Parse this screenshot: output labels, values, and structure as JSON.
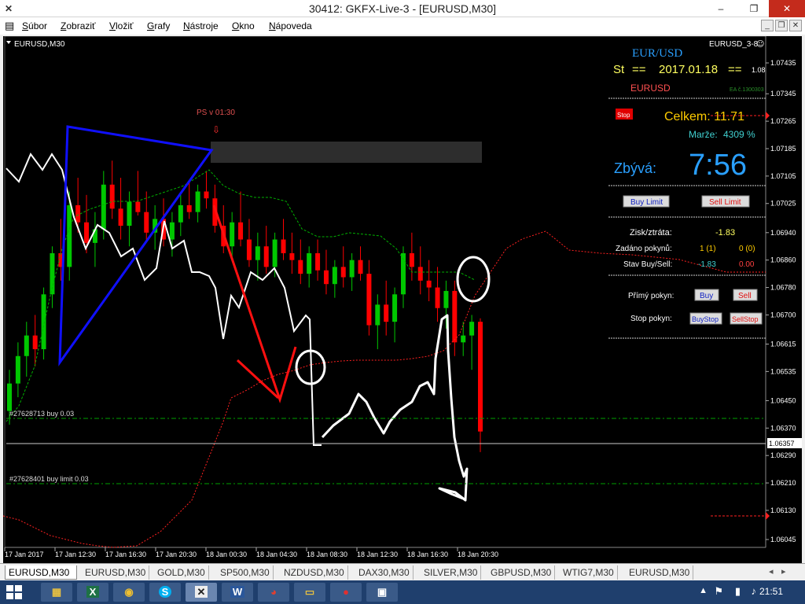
{
  "window": {
    "title": "30412: GKFX-Live-3 - [EURUSD,M30]",
    "minimize": "–",
    "restore": "❐",
    "close": "✕"
  },
  "menu": [
    "Súbor",
    "Zobraziť",
    "Vložiť",
    "Grafy",
    "Nástroje",
    "Okno",
    "Nápoveda"
  ],
  "chart": {
    "symbol_label": "EURUSD,M30",
    "ea_name": "EURUSD_3-8",
    "ps_label": "PS v 01:30",
    "current_price": "1.06357",
    "price_ticks": [
      "1.07435",
      "1.07345",
      "1.07265",
      "1.07185",
      "1.07105",
      "1.07025",
      "1.06940",
      "1.06860",
      "1.06780",
      "1.06700",
      "1.06615",
      "1.06535",
      "1.06450",
      "1.06370",
      "1.06290",
      "1.06210",
      "1.06130",
      "1.06045"
    ],
    "time_ticks": [
      "17 Jan 2017",
      "17 Jan 12:30",
      "17 Jan 16:30",
      "17 Jan 20:30",
      "18 Jan 00:30",
      "18 Jan 04:30",
      "18 Jan 08:30",
      "18 Jan 12:30",
      "18 Jan 16:30",
      "18 Jan 20:30"
    ],
    "order_buy": "#27628713 buy 0.03",
    "order_buy_limit": "#27628401 buy limit 0.03",
    "candles": [
      {
        "o": 1.0642,
        "h": 1.0654,
        "l": 1.0638,
        "c": 1.065
      },
      {
        "o": 1.065,
        "h": 1.0662,
        "l": 1.0646,
        "c": 1.0658
      },
      {
        "o": 1.0658,
        "h": 1.0668,
        "l": 1.0652,
        "c": 1.0664
      },
      {
        "o": 1.0664,
        "h": 1.067,
        "l": 1.0655,
        "c": 1.066
      },
      {
        "o": 1.066,
        "h": 1.0678,
        "l": 1.0657,
        "c": 1.0676
      },
      {
        "o": 1.0676,
        "h": 1.069,
        "l": 1.0672,
        "c": 1.0688
      },
      {
        "o": 1.0688,
        "h": 1.0698,
        "l": 1.068,
        "c": 1.0684
      },
      {
        "o": 1.0684,
        "h": 1.0706,
        "l": 1.068,
        "c": 1.0702
      },
      {
        "o": 1.0702,
        "h": 1.071,
        "l": 1.0694,
        "c": 1.0697
      },
      {
        "o": 1.0697,
        "h": 1.0705,
        "l": 1.0688,
        "c": 1.0691
      },
      {
        "o": 1.0691,
        "h": 1.07,
        "l": 1.0684,
        "c": 1.0695
      },
      {
        "o": 1.0695,
        "h": 1.0712,
        "l": 1.0692,
        "c": 1.0708
      },
      {
        "o": 1.0708,
        "h": 1.0715,
        "l": 1.0698,
        "c": 1.0701
      },
      {
        "o": 1.0701,
        "h": 1.071,
        "l": 1.0692,
        "c": 1.0696
      },
      {
        "o": 1.0696,
        "h": 1.0706,
        "l": 1.069,
        "c": 1.0703
      },
      {
        "o": 1.0703,
        "h": 1.0712,
        "l": 1.0699,
        "c": 1.07
      },
      {
        "o": 1.07,
        "h": 1.0706,
        "l": 1.0692,
        "c": 1.0694
      },
      {
        "o": 1.0694,
        "h": 1.0702,
        "l": 1.0689,
        "c": 1.0698
      },
      {
        "o": 1.0698,
        "h": 1.0704,
        "l": 1.069,
        "c": 1.0692
      },
      {
        "o": 1.0692,
        "h": 1.07,
        "l": 1.0687,
        "c": 1.0697
      },
      {
        "o": 1.0697,
        "h": 1.0705,
        "l": 1.0693,
        "c": 1.0702
      },
      {
        "o": 1.0702,
        "h": 1.0709,
        "l": 1.0698,
        "c": 1.07
      },
      {
        "o": 1.07,
        "h": 1.0708,
        "l": 1.0697,
        "c": 1.0706
      },
      {
        "o": 1.0706,
        "h": 1.0712,
        "l": 1.0701,
        "c": 1.0704
      },
      {
        "o": 1.0704,
        "h": 1.0708,
        "l": 1.0694,
        "c": 1.0696
      },
      {
        "o": 1.0696,
        "h": 1.0702,
        "l": 1.0688,
        "c": 1.069
      },
      {
        "o": 1.069,
        "h": 1.07,
        "l": 1.0686,
        "c": 1.0697
      },
      {
        "o": 1.0697,
        "h": 1.0706,
        "l": 1.069,
        "c": 1.0692
      },
      {
        "o": 1.0692,
        "h": 1.0698,
        "l": 1.0684,
        "c": 1.0686
      },
      {
        "o": 1.0686,
        "h": 1.0694,
        "l": 1.068,
        "c": 1.069
      },
      {
        "o": 1.069,
        "h": 1.0696,
        "l": 1.0682,
        "c": 1.0684
      },
      {
        "o": 1.0684,
        "h": 1.0694,
        "l": 1.0681,
        "c": 1.0692
      },
      {
        "o": 1.0692,
        "h": 1.0698,
        "l": 1.0686,
        "c": 1.0688
      },
      {
        "o": 1.0688,
        "h": 1.0694,
        "l": 1.0682,
        "c": 1.0686
      },
      {
        "o": 1.0686,
        "h": 1.0692,
        "l": 1.0679,
        "c": 1.0682
      },
      {
        "o": 1.0682,
        "h": 1.069,
        "l": 1.0678,
        "c": 1.0688
      },
      {
        "o": 1.0688,
        "h": 1.0692,
        "l": 1.068,
        "c": 1.0683
      },
      {
        "o": 1.0683,
        "h": 1.0689,
        "l": 1.0676,
        "c": 1.0679
      },
      {
        "o": 1.0679,
        "h": 1.0686,
        "l": 1.0675,
        "c": 1.0684
      },
      {
        "o": 1.0684,
        "h": 1.069,
        "l": 1.0678,
        "c": 1.0681
      },
      {
        "o": 1.0681,
        "h": 1.0688,
        "l": 1.0677,
        "c": 1.0686
      },
      {
        "o": 1.0686,
        "h": 1.069,
        "l": 1.068,
        "c": 1.0682
      },
      {
        "o": 1.0682,
        "h": 1.0686,
        "l": 1.0664,
        "c": 1.0667
      },
      {
        "o": 1.0667,
        "h": 1.0676,
        "l": 1.066,
        "c": 1.0673
      },
      {
        "o": 1.0673,
        "h": 1.068,
        "l": 1.0664,
        "c": 1.0668
      },
      {
        "o": 1.0668,
        "h": 1.0678,
        "l": 1.0662,
        "c": 1.0676
      },
      {
        "o": 1.0676,
        "h": 1.069,
        "l": 1.0672,
        "c": 1.0688
      },
      {
        "o": 1.0688,
        "h": 1.0694,
        "l": 1.068,
        "c": 1.0684
      },
      {
        "o": 1.0684,
        "h": 1.069,
        "l": 1.0676,
        "c": 1.068
      },
      {
        "o": 1.068,
        "h": 1.0686,
        "l": 1.0674,
        "c": 1.0678
      },
      {
        "o": 1.0678,
        "h": 1.0684,
        "l": 1.0668,
        "c": 1.0672
      },
      {
        "o": 1.0672,
        "h": 1.068,
        "l": 1.0666,
        "c": 1.0677
      },
      {
        "o": 1.0677,
        "h": 1.068,
        "l": 1.0658,
        "c": 1.0662
      },
      {
        "o": 1.0662,
        "h": 1.0668,
        "l": 1.0658,
        "c": 1.0664
      },
      {
        "o": 1.0664,
        "h": 1.067,
        "l": 1.0654,
        "c": 1.0668
      },
      {
        "o": 1.0668,
        "h": 1.0669,
        "l": 1.063,
        "c": 1.0636
      }
    ]
  },
  "panel": {
    "pair": "EUR/USD",
    "day": "St",
    "date": "2017.01.18",
    "sep": "==",
    "version": "1.08",
    "symbol": "EURUSD",
    "ea_ver": "EA č.1300303",
    "stop_btn": "Stop",
    "total_label": "Celkem: 11.71",
    "margin_label": "Marže:",
    "margin_value": "4309 %",
    "remaining_label": "Zbývá:",
    "remaining_time": "7:56",
    "buy_limit_btn": "Buy Limit",
    "sell_limit_btn": "Sell Limit",
    "pl_label": "Zisk/ztráta:",
    "pl_value": "-1.83",
    "orders_label": "Zadáno pokynů:",
    "orders_buy": "1 (1)",
    "orders_sell": "0 (0)",
    "state_label": "Stav Buy/Sell:",
    "state_buy": "-1.83",
    "state_sell": "0.00",
    "direct_label": "Přímý pokyn:",
    "buy_btn": "Buy",
    "sell_btn": "Sell",
    "stop_label": "Stop pokyn:",
    "buystop_btn": "BuyStop",
    "sellstop_btn": "SellStop"
  },
  "tabs": [
    "EURUSD,M30",
    "EURUSD,M30",
    "GOLD,M30",
    "SP500,M30",
    "NZDUSD,M30",
    "DAX30,M30",
    "SILVER,M30",
    "GBPUSD,M30",
    "WTIG7,M30",
    "EURUSD,M30"
  ],
  "taskbar": {
    "clock": "21:51",
    "apps": [
      "folder-icon",
      "excel-icon",
      "finance-icon",
      "skype-icon",
      "metatrader-icon",
      "word-icon",
      "chrome-icon",
      "explorer-icon",
      "media-icon",
      "paint-icon"
    ]
  },
  "colors": {
    "bull": "#00c800",
    "bear": "#ff0000",
    "panel_cyan": "#00a8ff",
    "gold": "#ffcc00"
  }
}
